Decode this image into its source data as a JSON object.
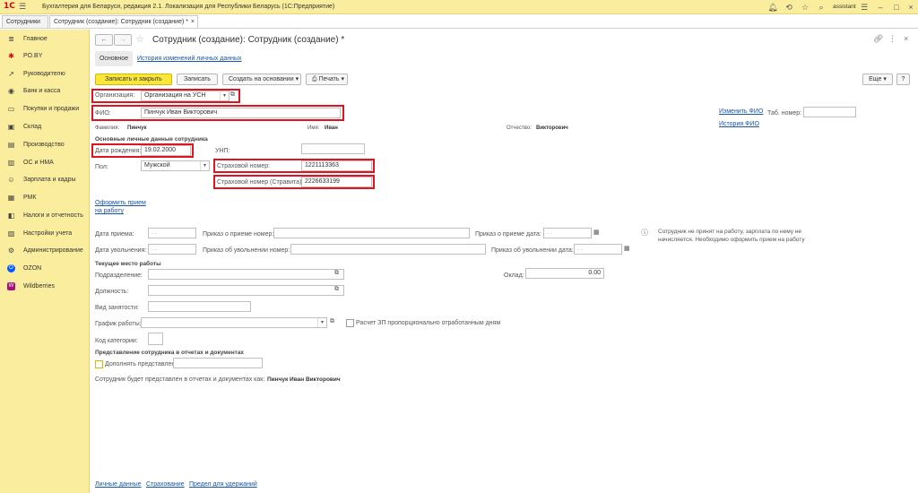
{
  "titlebar": {
    "logo": "1С",
    "title": "Бухгалтерия для Беларуси, редакция 2.1. Локализация для Республики Беларусь  (1С:Предприятие)",
    "user": "assistant"
  },
  "tabs": [
    {
      "label": "Сотрудники",
      "close": "×"
    },
    {
      "label": "Сотрудник (создание): Сотрудник (создание) *",
      "close": "×"
    }
  ],
  "sidebar": {
    "items": [
      {
        "label": "Главное",
        "icon": "≣"
      },
      {
        "label": "PO.BY",
        "icon": "✱"
      },
      {
        "label": "Руководителю",
        "icon": "↗"
      },
      {
        "label": "Банк и касса",
        "icon": "◉"
      },
      {
        "label": "Покупки и продажи",
        "icon": "▭"
      },
      {
        "label": "Склад",
        "icon": "▣"
      },
      {
        "label": "Производство",
        "icon": "▤"
      },
      {
        "label": "ОС и НМА",
        "icon": "▥"
      },
      {
        "label": "Зарплата и кадры",
        "icon": "☺"
      },
      {
        "label": "РМК",
        "icon": "▦"
      },
      {
        "label": "Налоги и отчетность",
        "icon": "◧"
      },
      {
        "label": "Настройки учета",
        "icon": "▨"
      },
      {
        "label": "Администрирование",
        "icon": "⚙"
      },
      {
        "label": "OZON",
        "icon": "O"
      },
      {
        "label": "Wildberries",
        "icon": "W"
      }
    ]
  },
  "form": {
    "title": "Сотрудник (создание): Сотрудник (создание) *",
    "nav_back": "←",
    "nav_forward": "→",
    "star": "☆",
    "tab_main": "Основное",
    "tab_history": "История изменений личных данных",
    "buttons": {
      "save_close": "Записать и закрыть",
      "save": "Записать",
      "create_based": "Создать на основании",
      "print": "Печать",
      "more": "Еще",
      "help": "?"
    },
    "org_label": "Организация:",
    "org_value": "Организация на УСН",
    "fio_label": "ФИО:",
    "fio_value": "Пинчук Иван Викторович",
    "change_fio": "Изменить ФИО",
    "fio_history": "История ФИО",
    "tab_no_label": "Таб. номер:",
    "surname_label": "Фамилия:",
    "surname_value": "Пинчук",
    "name_label": "Имя:",
    "name_value": "Иван",
    "patronymic_label": "Отчество:",
    "patronymic_value": "Викторович",
    "personal_section": "Основные личные данные сотрудника",
    "birth_label": "Дата рождения:",
    "birth_value": "19.02.2000",
    "unp_label": "УНП:",
    "gender_label": "Пол:",
    "gender_value": "Мужской",
    "ins_label": "Страховой номер:",
    "ins_value": "1221113363",
    "ins_stravita_label": "Страховой номер (Стравита):",
    "ins_stravita_value": "2226633199",
    "hire_link": "Оформить прием на работу",
    "hire_date_label": "Дата приема:",
    "hire_order_label": "Приказ о приеме номер:",
    "hire_order_date_label": "Приказ о приеме дата:",
    "fire_date_label": "Дата увольнения:",
    "fire_order_label": "Приказ об увольнении номер:",
    "fire_order_date_label": "Приказ об увольнении дата:",
    "date_placeholder": ".  .",
    "info_text": "Сотрудник не принят на работу, зарплата по нему не начисляется. Необходимо оформить прием на работу",
    "workplace_section": "Текущее место работы",
    "dept_label": "Подразделение:",
    "salary_label": "Оклад:",
    "salary_value": "0.00",
    "position_label": "Должность:",
    "employment_label": "Вид занятости:",
    "schedule_label": "График работы:",
    "calc_label": "Расчет ЗП пропорционально отработанным дням",
    "category_label": "Код категории:",
    "repr_section": "Представление сотрудника в отчетах и документах",
    "repr_check_label": "Дополнять представление",
    "repr_text": "Сотрудник будет представлен в отчетах и документах как:",
    "repr_value": "Пинчук Иван Викторович",
    "footer_links": [
      "Личные данные",
      "Страхование",
      "Предел для удержаний"
    ]
  }
}
